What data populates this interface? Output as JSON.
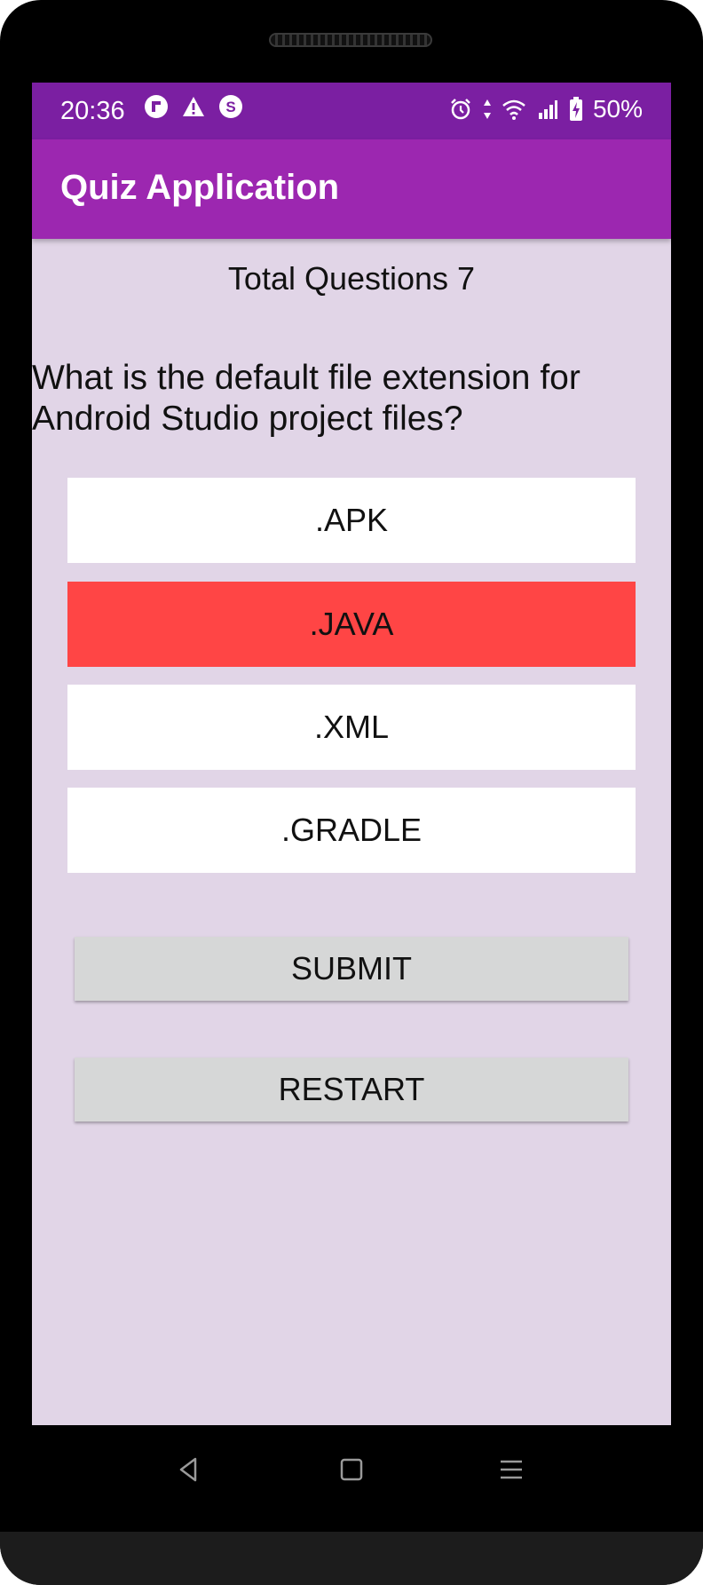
{
  "status_bar": {
    "time": "20:36",
    "left_icons": [
      "flipboard-icon",
      "warning-icon",
      "s-circle-icon"
    ],
    "right_icons": [
      "alarm-icon",
      "data-arrows-icon",
      "wifi-icon",
      "signal-icon",
      "battery-icon"
    ],
    "battery": "50%"
  },
  "app_bar": {
    "title": "Quiz Application"
  },
  "quiz": {
    "total_questions": "Total Questions 7",
    "question": "What is the default file extension for Android Studio project files?",
    "answers": [
      {
        "label": ".APK",
        "selected": false
      },
      {
        "label": ".JAVA",
        "selected": true
      },
      {
        "label": ".XML",
        "selected": false
      },
      {
        "label": ".GRADLE",
        "selected": false
      }
    ],
    "selected_color": "#ff4545",
    "submit_label": "SUBMIT",
    "restart_label": "RESTART"
  },
  "nav_bar": {
    "icons": [
      "back-icon",
      "home-icon",
      "recents-icon"
    ]
  },
  "colors": {
    "status_bar": "#7b1fa2",
    "app_bar": "#9c27b0",
    "background": "#e1d5e7",
    "button": "#d6d7d7"
  }
}
